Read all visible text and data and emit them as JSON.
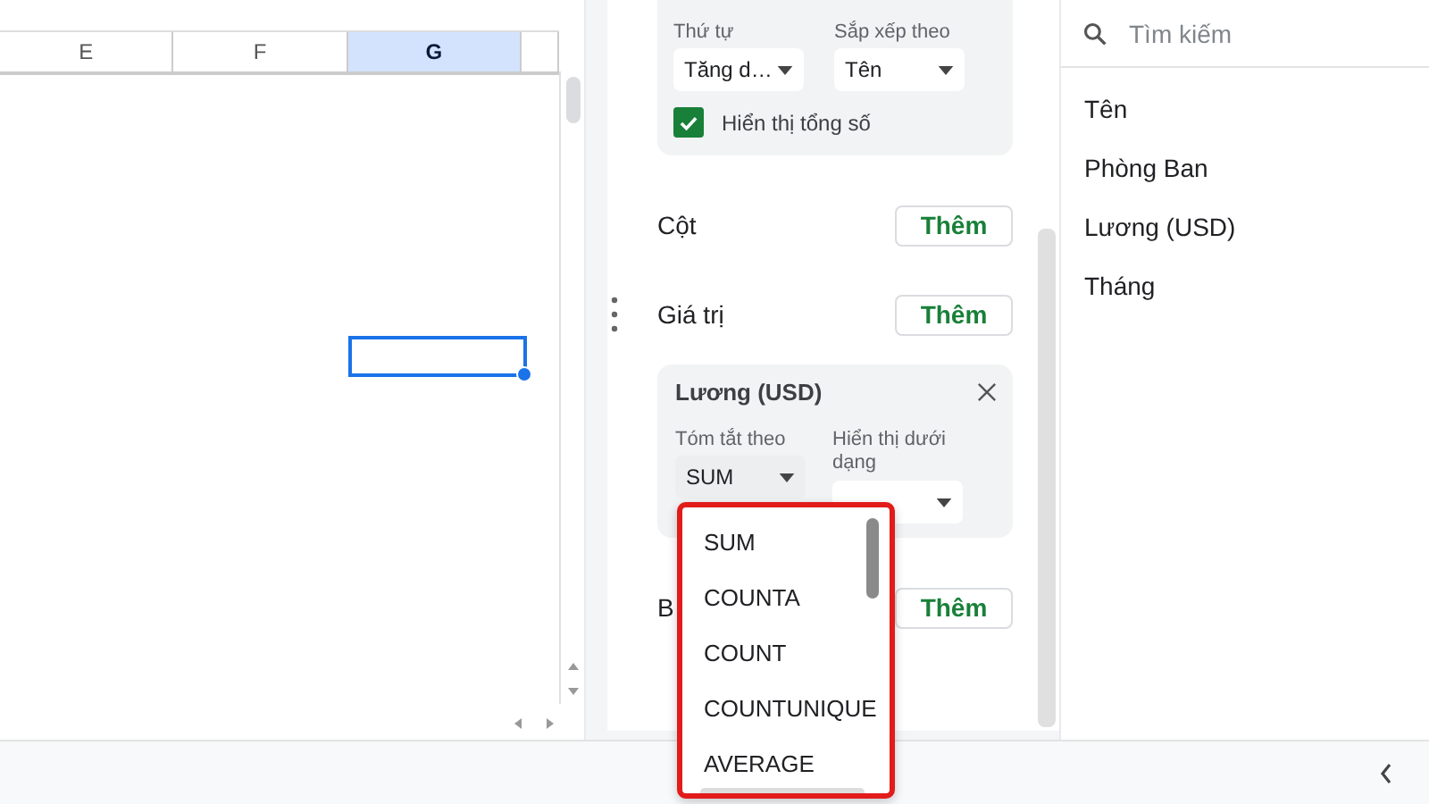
{
  "sheet": {
    "columns": [
      {
        "label": "E",
        "selected": false
      },
      {
        "label": "F",
        "selected": false
      },
      {
        "label": "G",
        "selected": true
      }
    ]
  },
  "editor": {
    "sort_card": {
      "order_label": "Thứ tự",
      "order_value": "Tăng d…",
      "sort_by_label": "Sắp xếp theo",
      "sort_by_value": "Tên",
      "show_totals": {
        "label": "Hiển thị tổng số",
        "checked": true
      }
    },
    "sections": [
      {
        "label": "Cột",
        "button": "Thêm"
      },
      {
        "label": "Giá trị",
        "button": "Thêm"
      }
    ],
    "value_card": {
      "title": "Lương (USD)",
      "summarize_label": "Tóm tắt theo",
      "summarize_value": "SUM",
      "show_as_label": "Hiển thị dưới dạng"
    },
    "filters": {
      "label": "B",
      "button": "Thêm"
    }
  },
  "dropdown": {
    "options": [
      "SUM",
      "COUNTA",
      "COUNT",
      "COUNTUNIQUE",
      "AVERAGE"
    ]
  },
  "fields": {
    "search_placeholder": "Tìm kiếm",
    "items": [
      "Tên",
      "Phòng Ban",
      "Lương (USD)",
      "Tháng"
    ]
  }
}
